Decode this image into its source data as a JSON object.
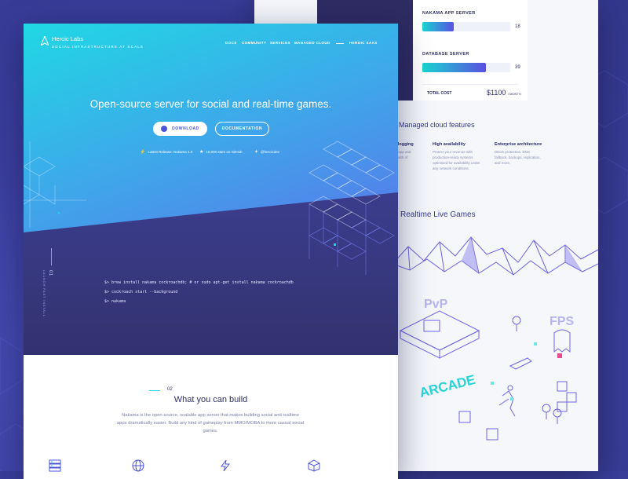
{
  "brand": {
    "name": "Heroic Labs",
    "tagline": "SOCIAL INFRASTRUCTURE AT SCALE"
  },
  "nav": {
    "items": [
      "DOCS",
      "COMMUNITY",
      "SERVICES",
      "MANAGED CLOUD"
    ],
    "highlight": "HEROIC SAAS"
  },
  "hero": {
    "headline": "Open-source server for social and real-time games.",
    "download_label": "DOWNLOAD",
    "docs_label": "DOCUMENTATION",
    "release": "Latest Release: Nakama 1.0",
    "stars": "10,000 stars on GitHub",
    "twitter": "@heroicdev"
  },
  "terminal": {
    "lines": [
      "$> brew install nakama cockroachdb; # or sudo apt-get install nakama cockroachdb",
      "$> cockroach start --background",
      "$> nakama"
    ]
  },
  "section1": {
    "number": "01",
    "subtitle": "LAUNCH FAST INSTALL"
  },
  "section2": {
    "number": "02",
    "title": "What you can build",
    "body": "Nakama is the open-source, scalable app server that makes building social and realtime apps dramatically easier. Build any kind of gameplay from MMO/MOBA to more casual social games."
  },
  "pricing": {
    "app_server_label": "NAKAMA APP SERVER",
    "app_server_value": "18",
    "app_server_fraction": 0.36,
    "db_server_label": "DATABASE SERVER",
    "db_server_value": "39",
    "db_server_fraction": 0.72,
    "total_label": "TOTAL COST",
    "total_value": "$1100",
    "total_unit": "/ MONTH"
  },
  "managed": {
    "title": "Managed cloud features",
    "features": [
      {
        "title": "d logging",
        "desc": "ur app and health of"
      },
      {
        "title": "High availability",
        "desc": "Protect your revenue with production-ready systems optimised for availability under any network conditions"
      },
      {
        "title": "Enterprise architecture",
        "desc": "DDoS protection, DNS fallback, backups, replication, and more."
      }
    ]
  },
  "realtime": {
    "title": "Realtime Live Games",
    "labels": [
      "PvP",
      "FPS",
      "ARCADE"
    ]
  },
  "colors": {
    "cyan": "#20d8e4",
    "indigo": "#2e2f6b",
    "violet": "#6a56e8",
    "background": "#3a3e9a"
  },
  "icons": [
    "github-icon",
    "lightning-icon",
    "star-icon",
    "twitter-icon",
    "server-icon",
    "globe-icon",
    "lightning-icon",
    "cube-icon"
  ]
}
